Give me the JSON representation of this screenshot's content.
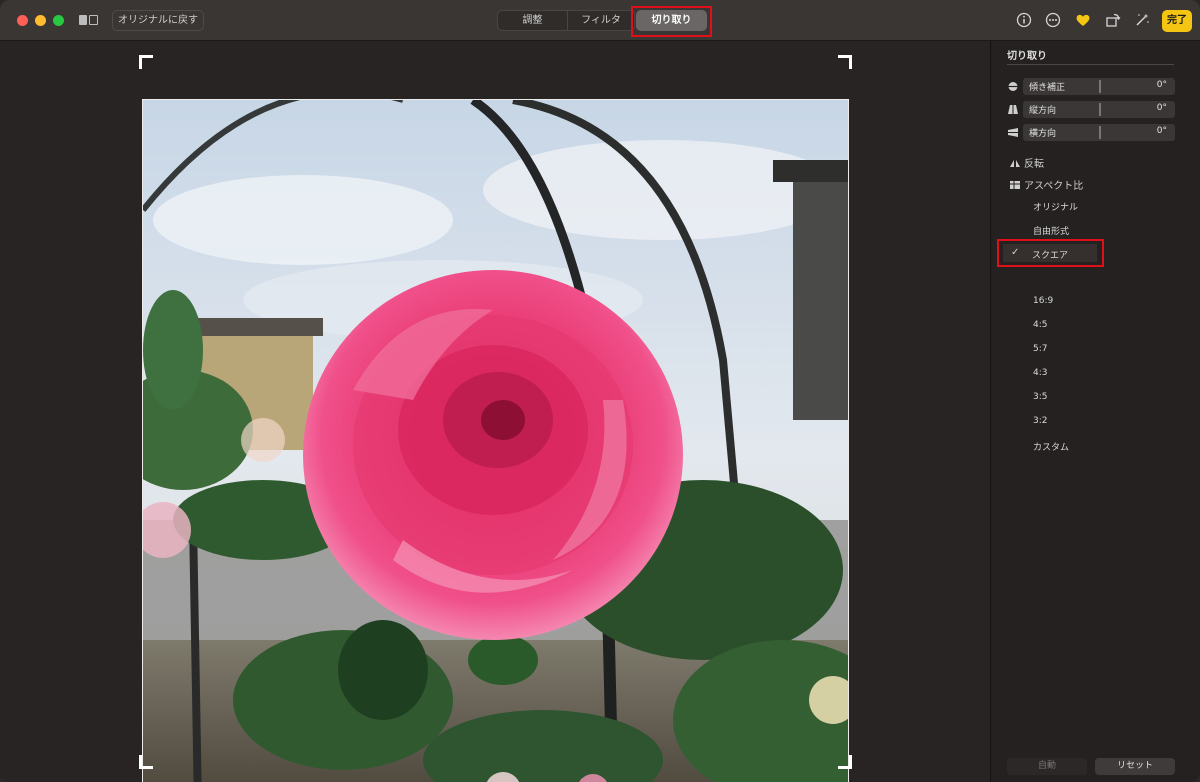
{
  "window": {
    "toolbar": {
      "revert_label": "オリジナルに戻す",
      "tabs": [
        {
          "label": "調整"
        },
        {
          "label": "フィルタ"
        },
        {
          "label": "切り取り"
        }
      ],
      "done_label": "完了",
      "icons": [
        "info-icon",
        "more-icon",
        "heart-icon",
        "rotate-icon",
        "auto-enhance-icon"
      ]
    },
    "sidebar": {
      "title": "切り取り",
      "sliders": [
        {
          "label": "傾き補正",
          "value": "0°",
          "icon": "straighten-icon"
        },
        {
          "label": "縦方向",
          "value": "0°",
          "icon": "vertical-icon"
        },
        {
          "label": "横方向",
          "value": "0°",
          "icon": "horizontal-icon"
        }
      ],
      "flip_label": "反転",
      "aspect_label": "アスペクト比",
      "aspect_options": [
        {
          "label": "オリジナル"
        },
        {
          "label": "自由形式"
        },
        {
          "label": "スクエア"
        },
        {
          "label": "16:9"
        },
        {
          "label": "4:5"
        },
        {
          "label": "5:7"
        },
        {
          "label": "4:3"
        },
        {
          "label": "3:5"
        },
        {
          "label": "3:2"
        },
        {
          "label": "カスタム"
        }
      ],
      "selected_check": "✓",
      "auto_label": "自動",
      "reset_label": "リセット"
    },
    "colors": {
      "accent_done": "#f4c512",
      "highlight_box": "#e0101a",
      "rose": "#ec3d78"
    }
  }
}
